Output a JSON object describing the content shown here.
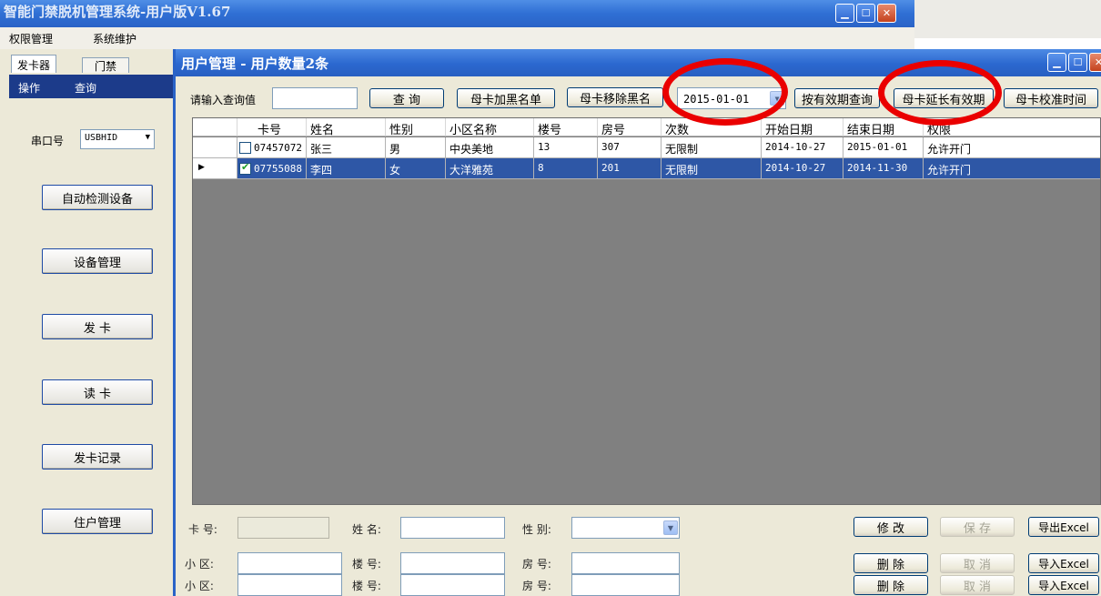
{
  "outer_window": {
    "title": "智能门禁脱机管理系统-用户版V1.67",
    "menu": [
      "权限管理",
      "系统维护"
    ]
  },
  "left_pane": {
    "tabs": [
      "发卡器",
      "门禁"
    ],
    "header": [
      "操作",
      "查询"
    ],
    "port_label": "串口号",
    "port_value": "USBHID",
    "buttons": [
      "自动检测设备",
      "设备管理",
      "发 卡",
      "读 卡",
      "发卡记录",
      "住户管理"
    ]
  },
  "user_window": {
    "title": "用户管理 - 用户数量2条",
    "query_label": "请输入查询值",
    "query_value": "",
    "btn_query": "查 询",
    "btn_add_blacklist": "母卡加黑名单",
    "btn_remove_blacklist": "母卡移除黑名",
    "date_value": "2015-01-01",
    "btn_query_by_expiry": "按有效期查询",
    "btn_extend_expiry": "母卡延长有效期",
    "btn_calibrate_time": "母卡校准时间"
  },
  "grid": {
    "columns": [
      "卡号",
      "姓名",
      "性别",
      "小区名称",
      "楼号",
      "房号",
      "次数",
      "开始日期",
      "结束日期",
      "权限"
    ],
    "rows": [
      {
        "checked": false,
        "selected": false,
        "cells": [
          "07457072",
          "张三",
          "男",
          "中央美地",
          "13",
          "307",
          "无限制",
          "2014-10-27",
          "2015-01-01",
          "允许开门"
        ]
      },
      {
        "checked": true,
        "selected": true,
        "cells": [
          "07755088",
          "李四",
          "女",
          "大洋雅苑",
          "8",
          "201",
          "无限制",
          "2014-10-27",
          "2014-11-30",
          "允许开门"
        ]
      }
    ]
  },
  "edit_panel": {
    "card_label": "卡 号:",
    "name_label": "姓 名:",
    "gender_label": "性 别:",
    "area_label": "小 区:",
    "building_label": "楼 号:",
    "room_label": "房 号:",
    "btn_modify": "修 改",
    "btn_save": "保 存",
    "btn_export": "导出Excel",
    "btn_delete": "删 除",
    "btn_cancel": "取 消",
    "btn_import": "导入Excel"
  },
  "annotation_color": "#ea0000"
}
